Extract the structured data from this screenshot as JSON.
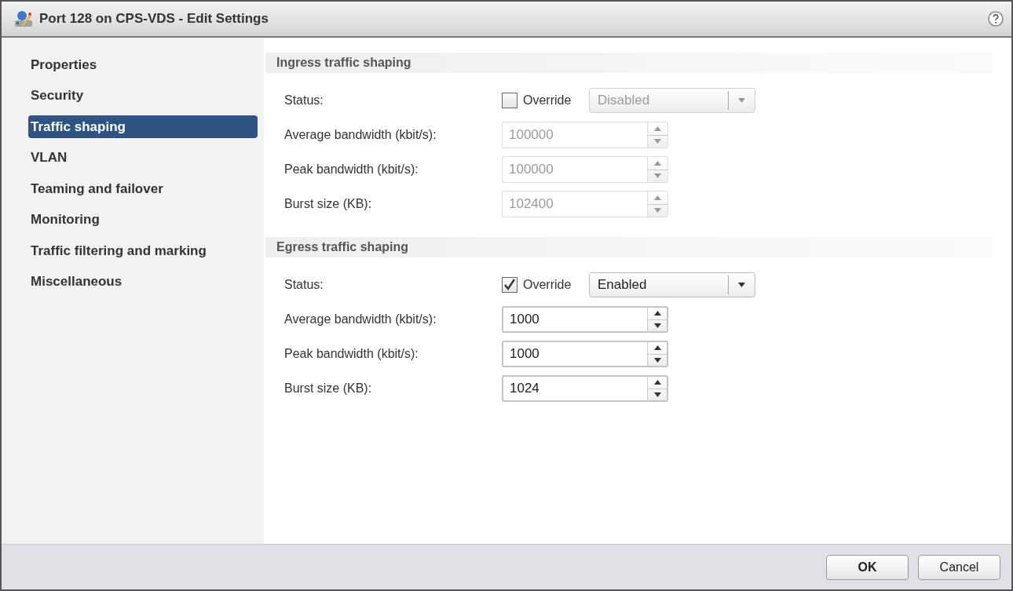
{
  "window": {
    "title": "Port 128 on CPS-VDS - Edit Settings"
  },
  "sidebar": {
    "items": [
      {
        "label": "Properties",
        "selected": false
      },
      {
        "label": "Security",
        "selected": false
      },
      {
        "label": "Traffic shaping",
        "selected": true
      },
      {
        "label": "VLAN",
        "selected": false
      },
      {
        "label": "Teaming and failover",
        "selected": false
      },
      {
        "label": "Monitoring",
        "selected": false
      },
      {
        "label": "Traffic filtering and marking",
        "selected": false
      },
      {
        "label": "Miscellaneous",
        "selected": false
      }
    ]
  },
  "sections": [
    {
      "title": "Ingress traffic shaping",
      "status_label": "Status:",
      "override": {
        "label": "Override",
        "checked": false
      },
      "status_value": "Disabled",
      "fields": [
        {
          "label": "Average bandwidth (kbit/s):",
          "value": "100000"
        },
        {
          "label": "Peak bandwidth (kbit/s):",
          "value": "100000"
        },
        {
          "label": "Burst size (KB):",
          "value": "102400"
        }
      ]
    },
    {
      "title": "Egress traffic shaping",
      "status_label": "Status:",
      "override": {
        "label": "Override",
        "checked": true
      },
      "status_value": "Enabled",
      "fields": [
        {
          "label": "Average bandwidth (kbit/s):",
          "value": "1000"
        },
        {
          "label": "Peak bandwidth (kbit/s):",
          "value": "1000"
        },
        {
          "label": "Burst size (KB):",
          "value": "1024"
        }
      ]
    }
  ],
  "buttons": [
    "OK",
    "Cancel"
  ]
}
